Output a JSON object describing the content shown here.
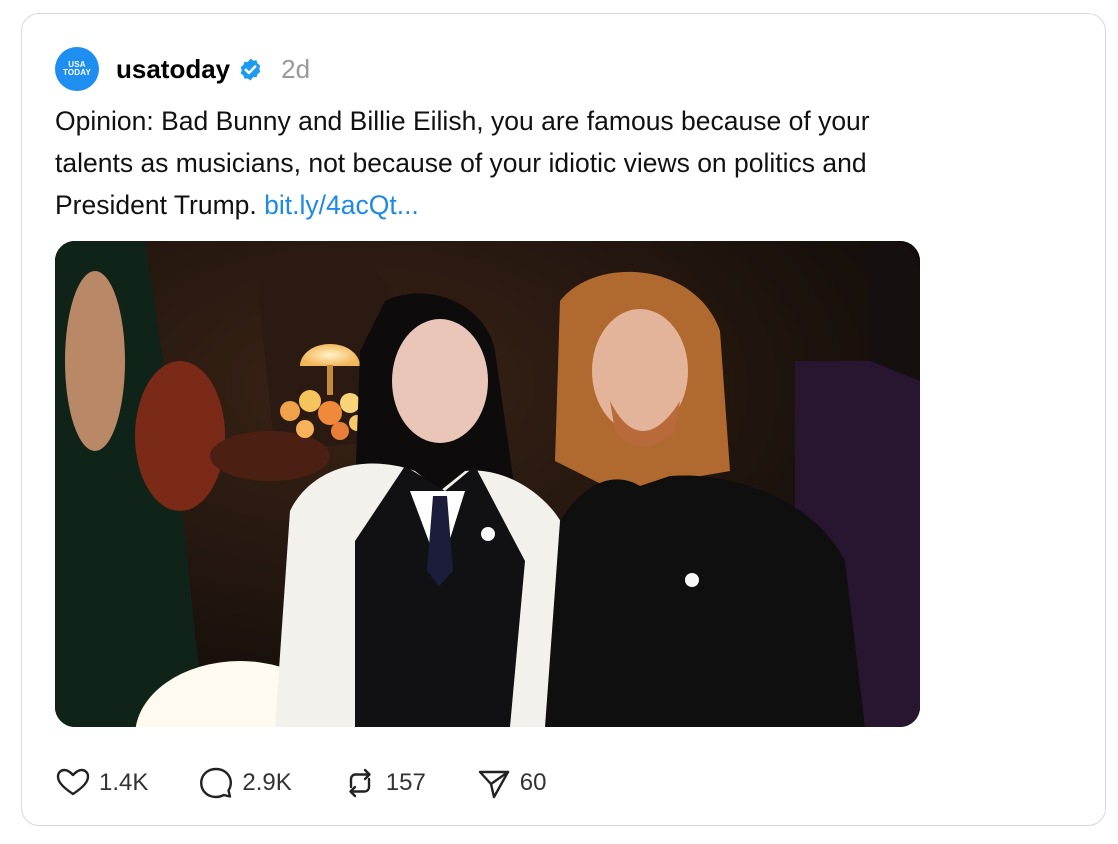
{
  "post": {
    "avatar_text_line1": "USA",
    "avatar_text_line2": "TODAY",
    "username": "usatoday",
    "verified": true,
    "timestamp": "2d",
    "text": "Opinion: Bad Bunny and Billie Eilish, you are famous because of your talents as musicians, not because of your idiotic views on politics and President Trump.",
    "link_text": "bit.ly/4acQt..."
  },
  "actions": {
    "likes": "1.4K",
    "replies": "2.9K",
    "reposts": "157",
    "shares": "60"
  },
  "colors": {
    "avatar": "#1f8ef1",
    "link": "#1d8ae8",
    "verified": "#1d9bf0",
    "timestamp": "#999999"
  },
  "icons": {
    "like": "heart-icon",
    "reply": "comment-bubble-icon",
    "repost": "repost-arrows-icon",
    "share": "send-paper-plane-icon",
    "verified": "verified-badge-icon"
  }
}
